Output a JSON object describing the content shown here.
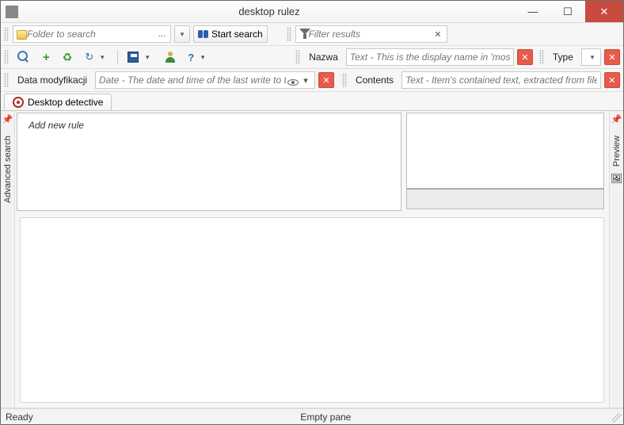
{
  "window": {
    "title": "desktop rulez"
  },
  "toolbar1": {
    "folder_placeholder": "Folder to search",
    "folder_button": "...",
    "start_search": "Start search",
    "filter_placeholder": "Filter results"
  },
  "toolbar2": {
    "col_name": "Nazwa",
    "name_placeholder": "Text - This is the display name in 'most comple",
    "col_type": "Type",
    "type_value": ""
  },
  "toolbar3": {
    "col_date": "Data modyfikacji",
    "date_placeholder": "Date - The date and time of the last write to the item",
    "col_contents": "Contents",
    "contents_placeholder": "Text - Item's contained text, extracted from file storage"
  },
  "tabs": {
    "detective": "Desktop detective"
  },
  "side": {
    "advanced_search": "Advanced search",
    "preview": "Preview"
  },
  "rules": {
    "add_new_rule": "Add new rule"
  },
  "status": {
    "ready": "Ready",
    "empty_pane": "Empty pane"
  }
}
